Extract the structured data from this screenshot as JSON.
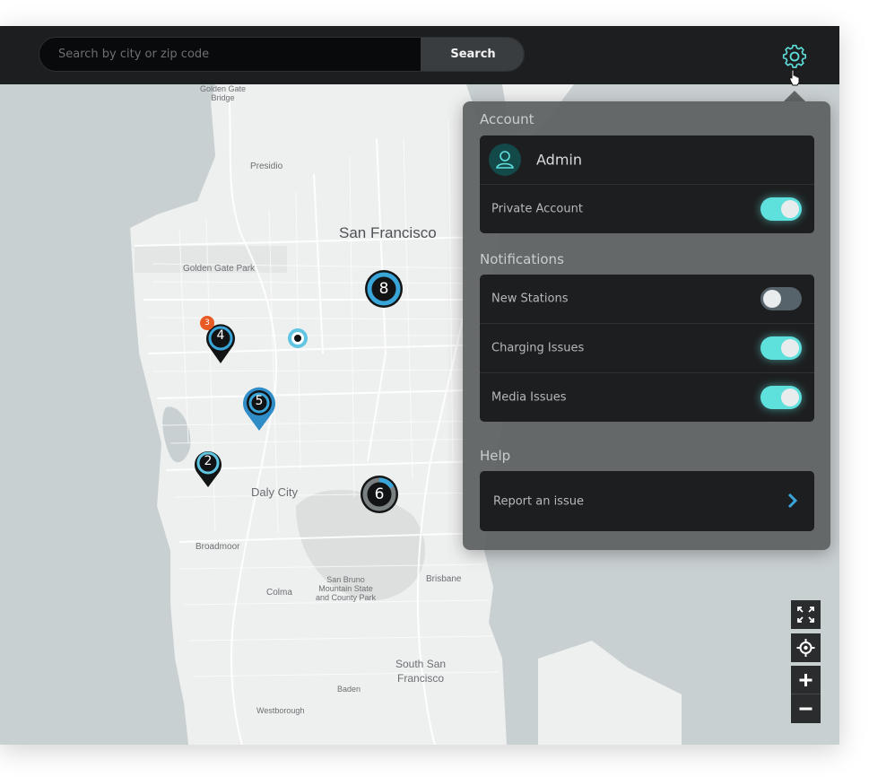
{
  "search": {
    "placeholder": "Search by city or zip code",
    "button_label": "Search"
  },
  "map": {
    "labels": {
      "golden_gate_bridge": "Golden Gate\nBridge",
      "presidio": "Presidio",
      "san_francisco": "San Francisco",
      "golden_gate_park": "Golden Gate Park",
      "daly_city": "Daly City",
      "broadmoor": "Broadmoor",
      "san_bruno": "San Bruno\nMountain State\nand County Park",
      "colma": "Colma",
      "brisbane": "Brisbane",
      "south_san_francisco": "South San\nFrancisco",
      "baden": "Baden",
      "westborough": "Westborough"
    },
    "markers": [
      {
        "count": "8",
        "badge": ""
      },
      {
        "count": "4",
        "badge": "3"
      },
      {
        "count": "5",
        "badge": ""
      },
      {
        "count": "2",
        "badge": ""
      },
      {
        "count": "6",
        "badge": ""
      }
    ]
  },
  "settings": {
    "account": {
      "title": "Account",
      "user_name": "Admin",
      "private_label": "Private Account",
      "private_on": true
    },
    "notifications": {
      "title": "Notifications",
      "items": [
        {
          "label": "New Stations",
          "on": false
        },
        {
          "label": "Charging Issues",
          "on": true
        },
        {
          "label": "Media Issues",
          "on": true
        }
      ]
    },
    "help": {
      "title": "Help",
      "report_label": "Report an issue"
    }
  },
  "colors": {
    "accent": "#5ee0dc",
    "marker_blue": "#3aa5d8",
    "badge": "#ea5a25",
    "panel": "#5c6060"
  },
  "icons": {
    "settings": "gear-icon",
    "user": "user-icon",
    "chevron": "chevron-right-icon",
    "expand": "expand-icon",
    "locate": "crosshair-icon",
    "zoom_in": "plus-icon",
    "zoom_out": "minus-icon"
  }
}
